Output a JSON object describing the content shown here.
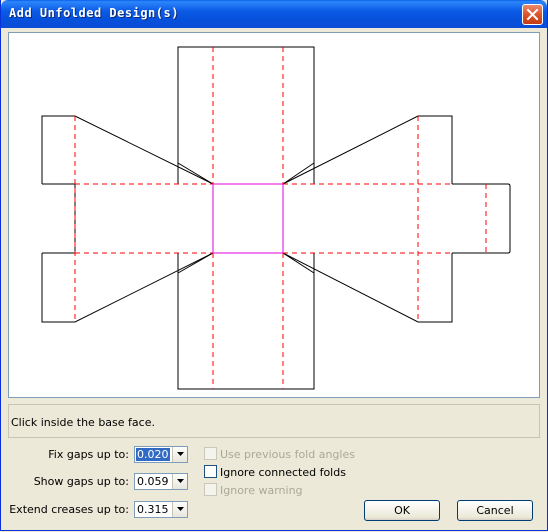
{
  "window": {
    "title": "Add Unfolded Design(s)"
  },
  "status": {
    "text": "Click inside the base face."
  },
  "options": {
    "fix_gaps": {
      "label": "Fix gaps up to:",
      "value": "0.020"
    },
    "show_gaps": {
      "label": "Show gaps up to:",
      "value": "0.059"
    },
    "extend": {
      "label": "Extend creases up to:",
      "value": "0.315"
    }
  },
  "checkboxes": [
    {
      "label": "Use previous fold angles",
      "checked": false,
      "enabled": false
    },
    {
      "label": "Ignore connected folds",
      "checked": false,
      "enabled": true
    },
    {
      "label": "Ignore warning",
      "checked": false,
      "enabled": false
    }
  ],
  "buttons": {
    "ok": "OK",
    "cancel": "Cancel"
  },
  "colors": {
    "cut": "#000000",
    "crease": "#ff0000",
    "base_face": "#e000e0",
    "title_bar": "#0a5ae6"
  },
  "icons": {
    "close": "close-icon",
    "dropdown": "chevron-down-icon"
  }
}
